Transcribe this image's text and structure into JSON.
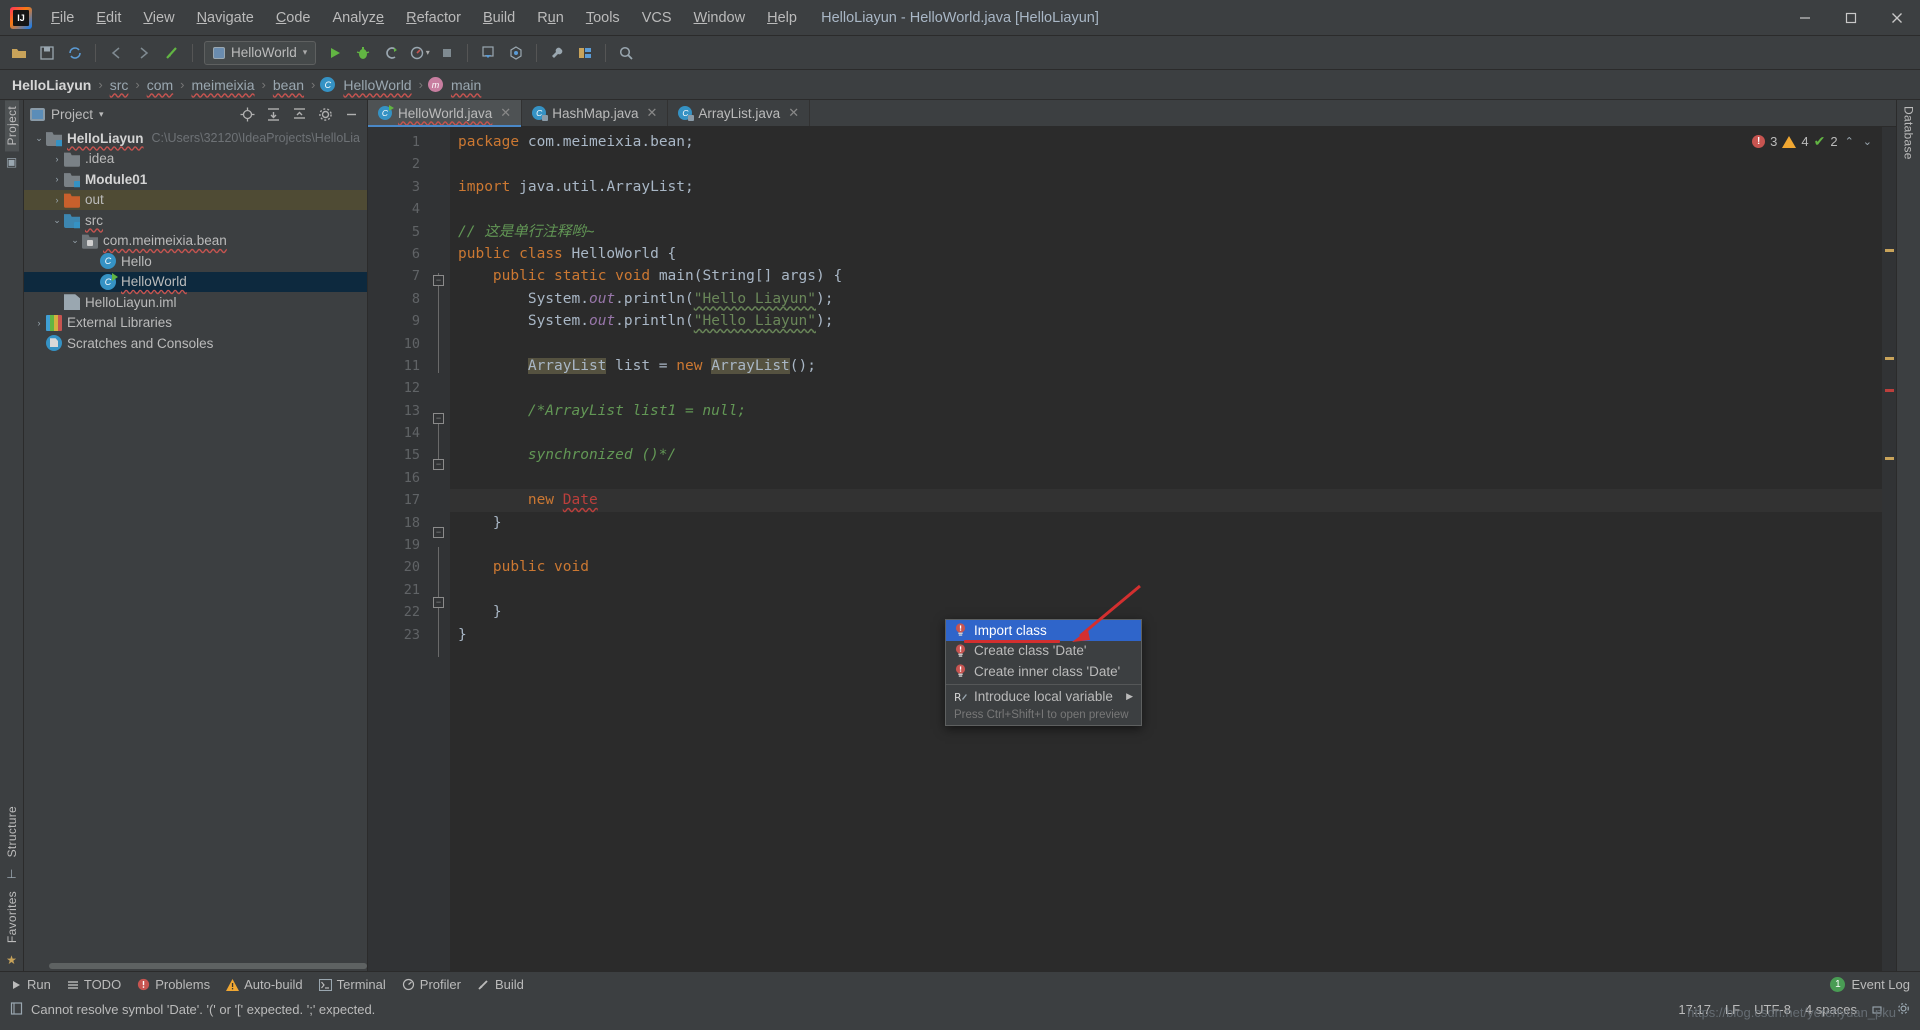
{
  "window": {
    "title": "HelloLiayun - HelloWorld.java [HelloLiayun]",
    "minimize": "—",
    "maximize": "▢",
    "close": "✕"
  },
  "menubar": {
    "items": [
      "File",
      "Edit",
      "View",
      "Navigate",
      "Code",
      "Analyze",
      "Refactor",
      "Build",
      "Run",
      "Tools",
      "VCS",
      "Window",
      "Help"
    ]
  },
  "toolbar": {
    "open_label": "open-project",
    "save_label": "save-all",
    "sync_label": "sync",
    "back_label": "back",
    "forward_label": "forward",
    "build_label": "build-project",
    "run_config": "HelloWorld",
    "run_label": "Run",
    "debug_label": "Debug",
    "run_coverage_label": "Run with Coverage",
    "profiler_label": "Profiler",
    "stop_label": "Stop",
    "update_label": "Update Project",
    "commit_label": "Commit",
    "settings_label": "Settings",
    "structure_label": "Project Structure",
    "search_label": "Search Everywhere"
  },
  "breadcrumb": {
    "items": [
      {
        "text": "HelloLiayun",
        "bold": true,
        "icon": ""
      },
      {
        "text": "src",
        "bold": false,
        "icon": ""
      },
      {
        "text": "com",
        "bold": false,
        "icon": ""
      },
      {
        "text": "meimeixia",
        "bold": false,
        "icon": ""
      },
      {
        "text": "bean",
        "bold": false,
        "icon": ""
      },
      {
        "text": "HelloWorld",
        "bold": false,
        "icon": "class-icon"
      },
      {
        "text": "main",
        "bold": false,
        "icon": "method-icon"
      }
    ],
    "separator": "›"
  },
  "left_rail": {
    "project": "Project",
    "structure": "Structure",
    "favorites": "Favorites"
  },
  "right_rail": {
    "database": "Database"
  },
  "project_panel": {
    "title": "Project",
    "caret": "▾",
    "toolbar": [
      "locate-icon",
      "expand-all-icon",
      "collapse-all-icon",
      "gear-icon",
      "hide-icon"
    ],
    "tree": [
      {
        "label": "HelloLiayun",
        "sub": "C:\\Users\\32120\\IdeaProjects\\HelloLia",
        "indent": 0,
        "arrow": "⌄",
        "icon": "folder-module",
        "bold": true,
        "state": "none",
        "squiggle": true
      },
      {
        "label": ".idea",
        "sub": "",
        "indent": 1,
        "arrow": "›",
        "icon": "folder",
        "bold": false,
        "state": "none",
        "squiggle": false
      },
      {
        "label": "Module01",
        "sub": "",
        "indent": 1,
        "arrow": "›",
        "icon": "folder-module",
        "bold": true,
        "state": "none",
        "squiggle": false
      },
      {
        "label": "out",
        "sub": "",
        "indent": 1,
        "arrow": "›",
        "icon": "folder-excluded",
        "bold": false,
        "state": "hl",
        "squiggle": false
      },
      {
        "label": "src",
        "sub": "",
        "indent": 1,
        "arrow": "⌄",
        "icon": "folder-source",
        "bold": false,
        "state": "none",
        "squiggle": true
      },
      {
        "label": "com.meimeixia.bean",
        "sub": "",
        "indent": 2,
        "arrow": "⌄",
        "icon": "package",
        "bold": false,
        "state": "none",
        "squiggle": true
      },
      {
        "label": "Hello",
        "sub": "",
        "indent": 3,
        "arrow": "",
        "icon": "class",
        "bold": false,
        "state": "none",
        "squiggle": false
      },
      {
        "label": "HelloWorld",
        "sub": "",
        "indent": 3,
        "arrow": "",
        "icon": "class-runnable",
        "bold": false,
        "state": "sel",
        "squiggle": true
      },
      {
        "label": "HelloLiayun.iml",
        "sub": "",
        "indent": 1,
        "arrow": "",
        "icon": "iml",
        "bold": false,
        "state": "none",
        "squiggle": false
      },
      {
        "label": "External Libraries",
        "sub": "",
        "indent": 0,
        "arrow": "›",
        "icon": "library",
        "bold": false,
        "state": "none",
        "squiggle": false
      },
      {
        "label": "Scratches and Consoles",
        "sub": "",
        "indent": 0,
        "arrow": "",
        "icon": "scratch",
        "bold": false,
        "state": "none",
        "squiggle": false
      }
    ]
  },
  "editor": {
    "tabs": [
      {
        "label": "HelloWorld.java",
        "icon": "class-runnable",
        "active": true,
        "close": "✕",
        "squiggle": true
      },
      {
        "label": "HashMap.java",
        "icon": "class-locked",
        "active": false,
        "close": "✕",
        "squiggle": false
      },
      {
        "label": "ArrayList.java",
        "icon": "class-locked",
        "active": false,
        "close": "✕",
        "squiggle": false
      }
    ],
    "inspection": {
      "errors": "3",
      "warnings": "4",
      "info": "2",
      "up": "⌃",
      "down": "⌄"
    },
    "lines": [
      {
        "n": "1",
        "text": "package com.meimeixia.bean;"
      },
      {
        "n": "2",
        "text": ""
      },
      {
        "n": "3",
        "text": "import java.util.ArrayList;"
      },
      {
        "n": "4",
        "text": ""
      },
      {
        "n": "5",
        "text": "// 这是单行注释哟~"
      },
      {
        "n": "6",
        "text": "public class HelloWorld {"
      },
      {
        "n": "7",
        "text": "    public static void main(String[] args) {"
      },
      {
        "n": "8",
        "text": "        System.out.println(\"Hello Liayun\");"
      },
      {
        "n": "9",
        "text": "        System.out.println(\"Hello Liayun\");"
      },
      {
        "n": "10",
        "text": ""
      },
      {
        "n": "11",
        "text": "        ArrayList list = new ArrayList();"
      },
      {
        "n": "12",
        "text": ""
      },
      {
        "n": "13",
        "text": "        /*ArrayList list1 = null;"
      },
      {
        "n": "14",
        "text": ""
      },
      {
        "n": "15",
        "text": "        synchronized ()*/"
      },
      {
        "n": "16",
        "text": ""
      },
      {
        "n": "17",
        "text": "        new Date"
      },
      {
        "n": "18",
        "text": "    }"
      },
      {
        "n": "19",
        "text": ""
      },
      {
        "n": "20",
        "text": "    public void"
      },
      {
        "n": "21",
        "text": ""
      },
      {
        "n": "22",
        "text": "    }"
      },
      {
        "n": "23",
        "text": "}"
      }
    ]
  },
  "popup": {
    "items": [
      {
        "label": "Import class",
        "icon": "bulb-error-icon",
        "selected": true,
        "submenu": ""
      },
      {
        "label": "Create class 'Date'",
        "icon": "bulb-error-icon",
        "selected": false,
        "submenu": ""
      },
      {
        "label": "Create inner class 'Date'",
        "icon": "bulb-error-icon",
        "selected": false,
        "submenu": ""
      },
      {
        "label": "Introduce local variable",
        "icon": "refactor-icon",
        "selected": false,
        "submenu": "▶"
      }
    ],
    "hint": "Press Ctrl+Shift+I to open preview"
  },
  "bottom_bar": {
    "items": [
      {
        "label": "Run",
        "icon": "run-icon"
      },
      {
        "label": "TODO",
        "icon": "todo-icon"
      },
      {
        "label": "Problems",
        "icon": "problems-icon"
      },
      {
        "label": "Auto-build",
        "icon": "warning-icon"
      },
      {
        "label": "Terminal",
        "icon": "terminal-icon"
      },
      {
        "label": "Profiler",
        "icon": "profiler-icon"
      },
      {
        "label": "Build",
        "icon": "build-icon"
      }
    ],
    "event_log": {
      "label": "Event Log",
      "count": "1"
    }
  },
  "status_bar": {
    "message": "Cannot resolve symbol 'Date'. '(' or '[' expected. ';' expected.",
    "caret": "17:17",
    "line_sep": "LF",
    "encoding": "UTF-8",
    "indent": "4 spaces",
    "watermark": "https://blog.csdn.net/yerenyuan_pku"
  },
  "colors": {
    "accent_blue": "#2f65ca",
    "error_red": "#c75450",
    "warn_orange": "#f0a732",
    "ok_green": "#62b543",
    "keyword": "#cc7832",
    "string": "#6a8759",
    "comment": "#629755"
  }
}
